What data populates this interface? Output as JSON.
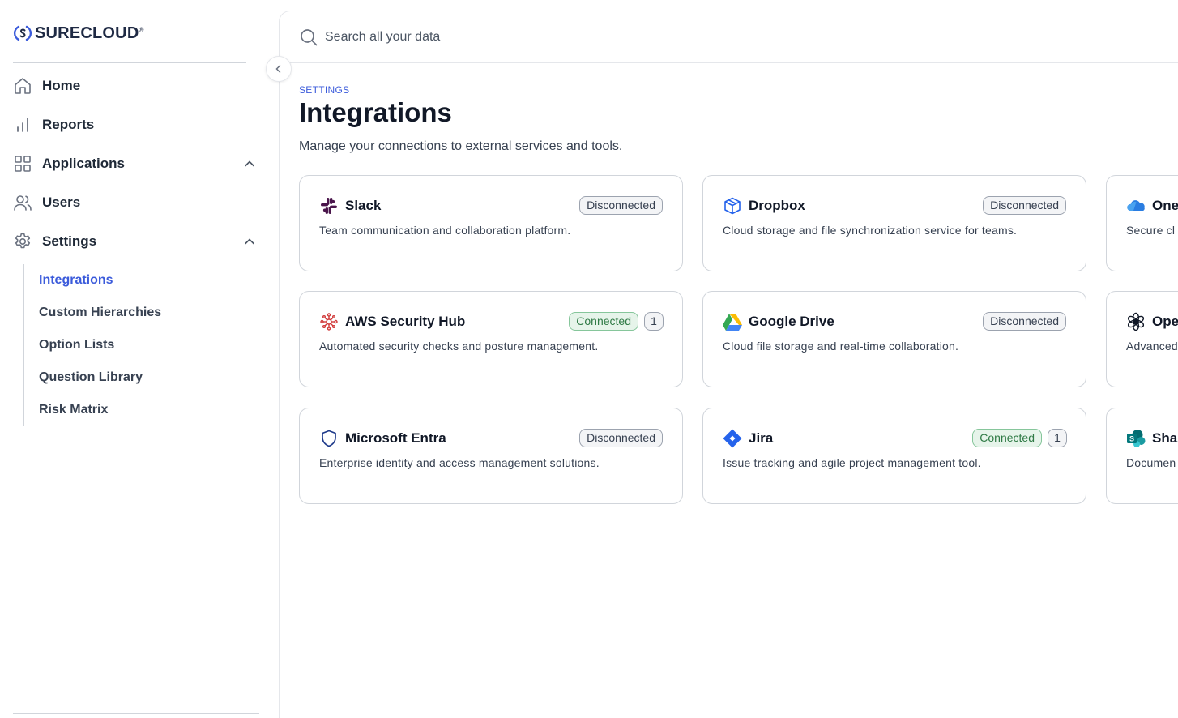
{
  "brand": {
    "name": "SURECLOUD",
    "reg": "®",
    "accent": "#3b5bdb"
  },
  "nav": {
    "items": [
      {
        "label": "Home",
        "icon": "home-icon"
      },
      {
        "label": "Reports",
        "icon": "bar-chart-icon"
      },
      {
        "label": "Applications",
        "icon": "grid-icon",
        "expanded": true
      },
      {
        "label": "Users",
        "icon": "users-icon"
      },
      {
        "label": "Settings",
        "icon": "gear-icon",
        "expanded": true
      }
    ],
    "settings_children": [
      {
        "label": "Integrations",
        "active": true
      },
      {
        "label": "Custom Hierarchies"
      },
      {
        "label": "Option Lists"
      },
      {
        "label": "Question Library"
      },
      {
        "label": "Risk Matrix"
      }
    ]
  },
  "search": {
    "placeholder": "Search all your data"
  },
  "page": {
    "breadcrumb": "SETTINGS",
    "title": "Integrations",
    "subtitle": "Manage your connections to external services and tools."
  },
  "integrations": [
    {
      "name": "Slack",
      "status": "Disconnected",
      "description": "Team communication and collaboration platform.",
      "icon": "slack-icon"
    },
    {
      "name": "Dropbox",
      "status": "Disconnected",
      "description": "Cloud storage and file synchronization service for teams.",
      "icon": "dropbox-icon"
    },
    {
      "name": "One",
      "description": "Secure cl",
      "icon": "onedrive-icon"
    },
    {
      "name": "AWS Security Hub",
      "status": "Connected",
      "count": "1",
      "description": "Automated security checks and posture management.",
      "icon": "aws-security-hub-icon"
    },
    {
      "name": "Google Drive",
      "status": "Disconnected",
      "description": "Cloud file storage and real-time collaboration.",
      "icon": "google-drive-icon"
    },
    {
      "name": "Ope",
      "description": "Advanced",
      "icon": "openai-icon"
    },
    {
      "name": "Microsoft Entra",
      "status": "Disconnected",
      "description": "Enterprise identity and access management solutions.",
      "icon": "shield-icon"
    },
    {
      "name": "Jira",
      "status": "Connected",
      "count": "1",
      "description": "Issue tracking and agile project management tool.",
      "icon": "jira-icon"
    },
    {
      "name": "Shar",
      "description": "Documen",
      "icon": "sharepoint-icon"
    }
  ]
}
